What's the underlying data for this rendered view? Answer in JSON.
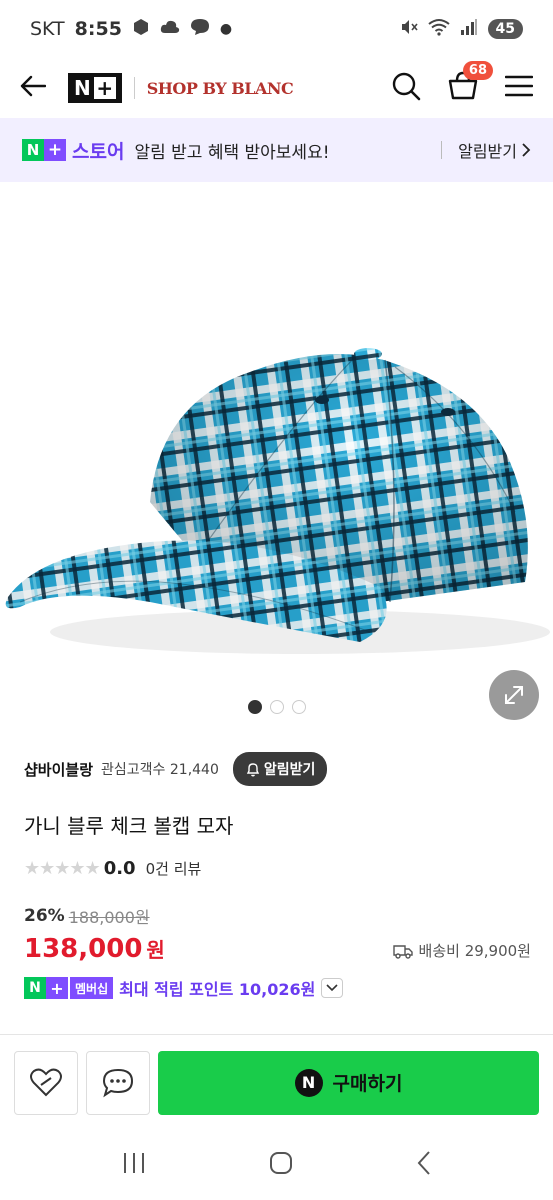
{
  "status_bar": {
    "carrier": "SKT",
    "time": "8:55",
    "battery": "45"
  },
  "header": {
    "logo_text": "N",
    "shop_logo": "SHOP BY BLANC",
    "cart_count": "68"
  },
  "promo": {
    "store": "스토어",
    "text": "알림 받고 혜택 받아보세요!",
    "cta": "알림받기"
  },
  "gallery": {
    "dots": 3,
    "active_index": 0
  },
  "seller": {
    "name": "샵바이블랑",
    "interest_label": "관심고객수",
    "interest_count": "21,440",
    "notify_label": "알림받기"
  },
  "product": {
    "title": "가니 블루 체크 볼캡 모자",
    "rating": "0.0",
    "review_count": "0건 리뷰",
    "discount": "26%",
    "original_price": "188,000원",
    "price": "138,000",
    "price_unit": "원",
    "shipping": "배송비 29,900원"
  },
  "points": {
    "badge_label": "멤버십",
    "text": "최대 적립 포인트 10,026원"
  },
  "actions": {
    "buy_label": "구매하기",
    "buy_icon_letter": "N"
  },
  "colors": {
    "naver_green": "#03c75a",
    "plus_purple": "#7f4dff",
    "price_red": "#e11b2d",
    "buy_green": "#19cc4a"
  }
}
